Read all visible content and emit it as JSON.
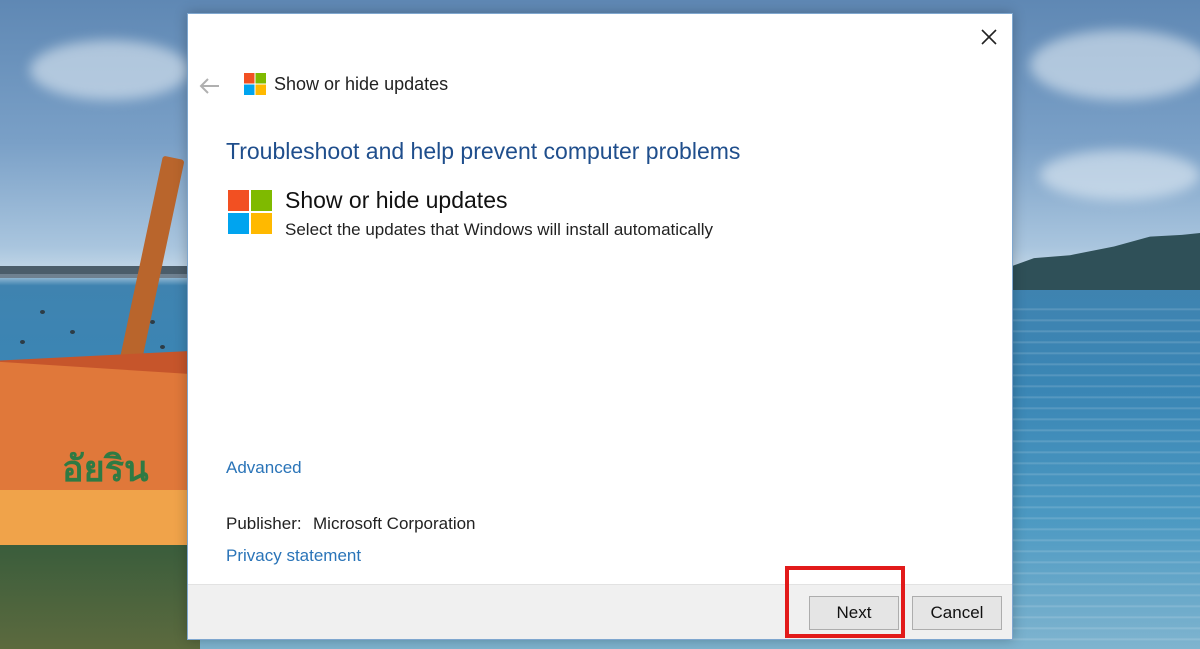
{
  "window": {
    "title": "Show or hide updates",
    "close_icon": "close-icon",
    "back_icon": "back-arrow-icon"
  },
  "content": {
    "heading": "Troubleshoot and help prevent computer problems",
    "item_title": "Show or hide updates",
    "item_description": "Select the updates that Windows will install automatically",
    "advanced_link": "Advanced",
    "publisher_label": "Publisher:",
    "publisher_value": "Microsoft Corporation",
    "privacy_link": "Privacy statement"
  },
  "buttons": {
    "next": "Next",
    "cancel": "Cancel"
  },
  "colors": {
    "heading": "#1f4e8c",
    "link": "#2a74b8",
    "highlight": "#e21a1a",
    "logo": [
      "#f25022",
      "#7fba00",
      "#00a4ef",
      "#ffb900"
    ]
  }
}
